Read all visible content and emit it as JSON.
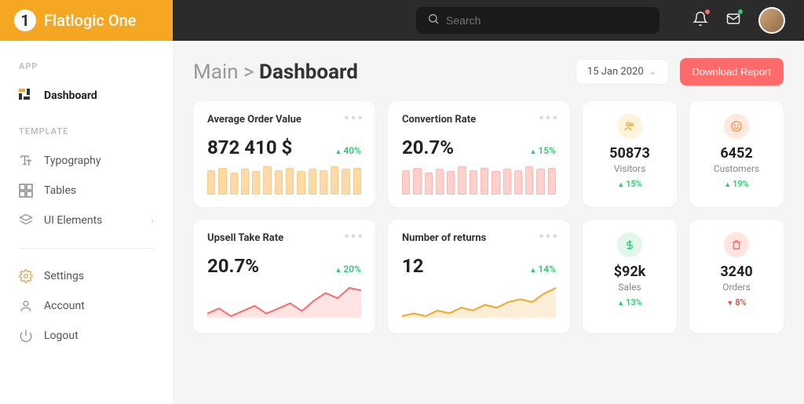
{
  "brand": {
    "name": "Flatlogic One",
    "logo_letter": "1"
  },
  "search": {
    "placeholder": "Search"
  },
  "sidebar": {
    "section_app": "APP",
    "section_template": "TEMPLATE",
    "items": [
      {
        "label": "Dashboard",
        "active": true
      },
      {
        "label": "Typography"
      },
      {
        "label": "Tables"
      },
      {
        "label": "UI Elements",
        "has_children": true
      }
    ],
    "footer": [
      {
        "label": "Settings"
      },
      {
        "label": "Account"
      },
      {
        "label": "Logout"
      }
    ]
  },
  "breadcrumb": {
    "parent": "Main",
    "sep": ">",
    "current": "Dashboard"
  },
  "date_picker": "15 Jan 2020",
  "download_btn": "Download Report",
  "kpi": [
    {
      "title": "Average Order Value",
      "value": "872 410 $",
      "delta": "40%",
      "dir": "up"
    },
    {
      "title": "Convertion Rate",
      "value": "20.7%",
      "delta": "15%",
      "dir": "up"
    },
    {
      "title": "Upsell Take Rate",
      "value": "20.7%",
      "delta": "20%",
      "dir": "up"
    },
    {
      "title": "Number of returns",
      "value": "12",
      "delta": "14%",
      "dir": "up"
    }
  ],
  "stats": [
    {
      "value": "50873",
      "label": "Visitors",
      "delta": "15%",
      "dir": "up"
    },
    {
      "value": "6452",
      "label": "Customers",
      "delta": "19%",
      "dir": "up"
    },
    {
      "value": "$92k",
      "label": "Sales",
      "delta": "13%",
      "dir": "up"
    },
    {
      "value": "3240",
      "label": "Orders",
      "delta": "8%",
      "dir": "down"
    }
  ],
  "chart_data": [
    {
      "type": "bar",
      "card": "Average Order Value",
      "color": "orange",
      "values": [
        20,
        22,
        18,
        21,
        19,
        23,
        20,
        22,
        19,
        21,
        20,
        23,
        21,
        22
      ]
    },
    {
      "type": "bar",
      "card": "Convertion Rate",
      "color": "coral",
      "values": [
        20,
        22,
        18,
        21,
        19,
        23,
        20,
        22,
        19,
        21,
        20,
        23,
        21,
        22
      ]
    },
    {
      "type": "line",
      "card": "Upsell Take Rate",
      "color": "#ff6b6b",
      "values": [
        12,
        14,
        11,
        13,
        15,
        12,
        14,
        16,
        13,
        17,
        20,
        18,
        22,
        21
      ]
    },
    {
      "type": "area",
      "card": "Number of returns",
      "color": "#f5a623",
      "values": [
        10,
        11,
        10,
        12,
        11,
        13,
        12,
        14,
        13,
        15,
        16,
        15,
        18,
        20
      ]
    }
  ]
}
